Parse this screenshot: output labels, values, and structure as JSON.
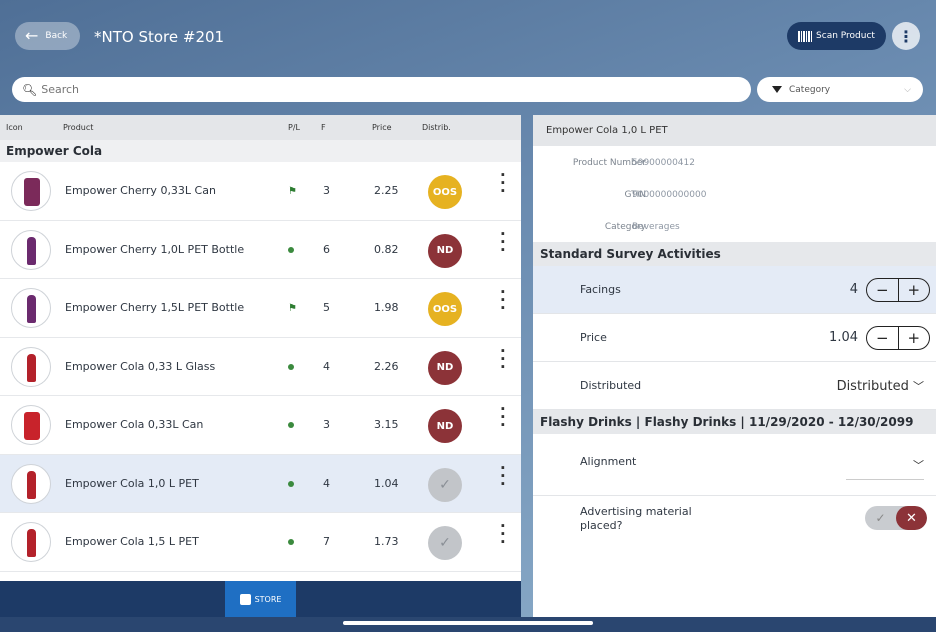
{
  "header": {
    "back_label": "Back",
    "store_title": "*NTO Store #201",
    "scan_label": "Scan Product",
    "more_icon": "vertical-dots-icon"
  },
  "search": {
    "placeholder": "Search",
    "category_placeholder": "Category"
  },
  "product_list": {
    "columns": [
      "Icon",
      "Product",
      "P/L",
      "F",
      "Price",
      "Distrib."
    ],
    "group": "Empower Cola",
    "rows": [
      {
        "name": "Empower Cherry 0,33L Can",
        "pl": "flag",
        "f": "3",
        "price": "2.25",
        "distrib": "OOS",
        "thumb": "can",
        "color": "#7b2a5a"
      },
      {
        "name": "Empower Cherry 1,0L PET Bottle",
        "pl": "dot",
        "f": "6",
        "price": "0.82",
        "distrib": "ND",
        "thumb": "bottle",
        "color": "#6b2a6e"
      },
      {
        "name": "Empower Cherry 1,5L PET Bottle",
        "pl": "flag",
        "f": "5",
        "price": "1.98",
        "distrib": "OOS",
        "thumb": "bottle",
        "color": "#6b2a6e"
      },
      {
        "name": "Empower Cola 0,33 L Glass",
        "pl": "dot",
        "f": "4",
        "price": "2.26",
        "distrib": "ND",
        "thumb": "bottle",
        "color": "#b3212a"
      },
      {
        "name": "Empower Cola 0,33L Can",
        "pl": "dot",
        "f": "3",
        "price": "3.15",
        "distrib": "ND",
        "thumb": "can",
        "color": "#c8232b"
      },
      {
        "name": "Empower Cola 1,0 L PET",
        "pl": "dot",
        "f": "4",
        "price": "1.04",
        "distrib": "check",
        "thumb": "bottle",
        "color": "#b3212a",
        "selected": true
      },
      {
        "name": "Empower Cola 1,5 L PET",
        "pl": "dot",
        "f": "7",
        "price": "1.73",
        "distrib": "check",
        "thumb": "bottle",
        "color": "#b3212a"
      }
    ]
  },
  "bottom_tab": {
    "label": "STORE"
  },
  "detail": {
    "title": "Empower Cola 1,0 L PET",
    "product_number_label": "Product Number",
    "product_number": "59900000412",
    "gtin_label": "GTIN",
    "gtin": "9000000000000",
    "category_label": "Category",
    "category": "Beverages",
    "section_standard": "Standard Survey Activities",
    "facings_label": "Facings",
    "facings_value": "4",
    "price_label": "Price",
    "price_value": "1.04",
    "distributed_label": "Distributed",
    "distributed_value": "Distributed",
    "section_promo": "Flashy Drinks | Flashy Drinks | 11/29/2020 - 12/30/2099",
    "alignment_label": "Alignment",
    "advertising_label_1": "Advertising material",
    "advertising_label_2": "placed?"
  }
}
